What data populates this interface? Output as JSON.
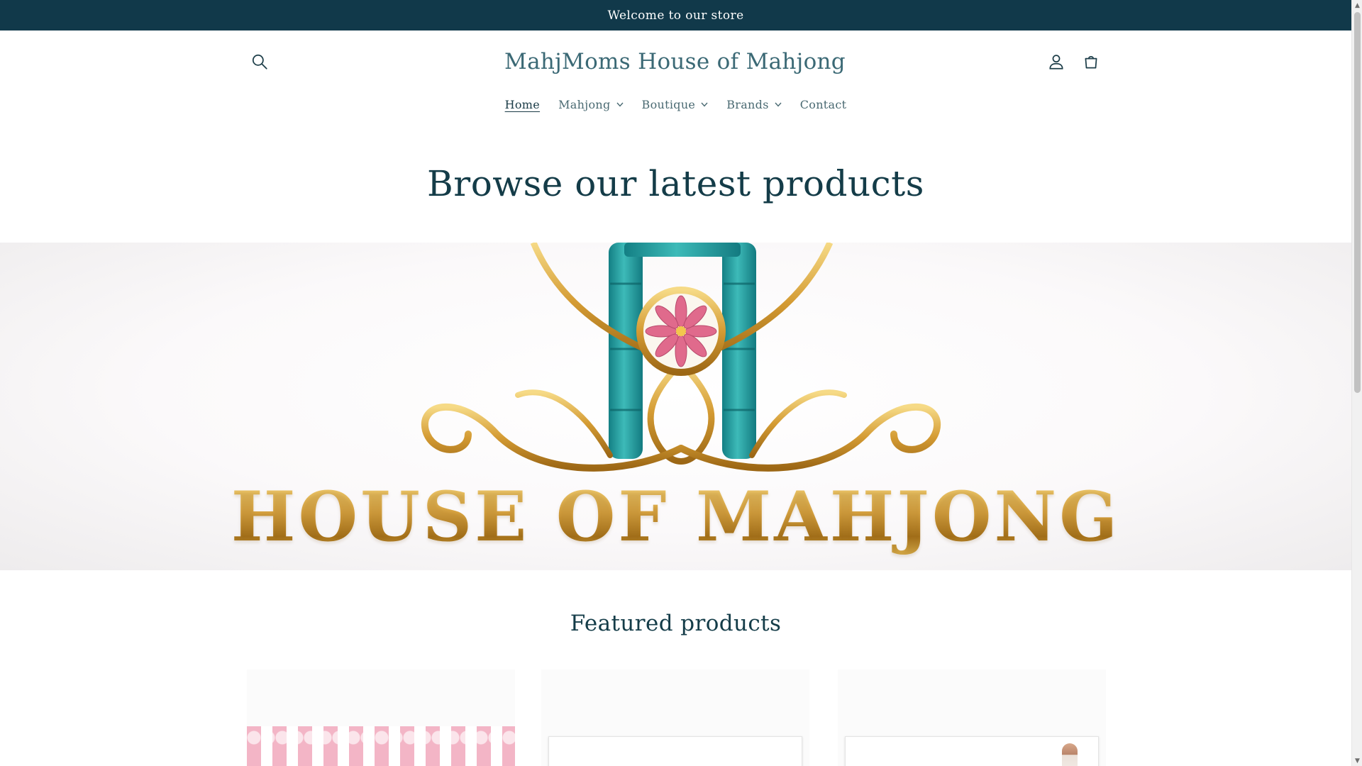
{
  "announcement": {
    "text": "Welcome to our store"
  },
  "header": {
    "store_name": "MahjMoms House of Mahjong",
    "icons": [
      "search-icon",
      "account-icon",
      "cart-icon"
    ]
  },
  "nav": {
    "items": [
      {
        "label": "Home",
        "active": true,
        "has_dropdown": false
      },
      {
        "label": "Mahjong",
        "active": false,
        "has_dropdown": true
      },
      {
        "label": "Boutique",
        "active": false,
        "has_dropdown": true
      },
      {
        "label": "Brands",
        "active": false,
        "has_dropdown": true
      },
      {
        "label": "Contact",
        "active": false,
        "has_dropdown": false
      }
    ]
  },
  "main": {
    "browse_heading": "Browse our latest products",
    "hero": {
      "logo_text": "HOUSE OF MAHJONG"
    },
    "featured_heading": "Featured products",
    "products": [
      {
        "kind": "pink striped product image"
      },
      {
        "kind": "boxed product image"
      },
      {
        "kind": "boxed product image with figure"
      }
    ]
  },
  "colors": {
    "announcement_bg": "#11394a",
    "heading_text": "#143c48",
    "gold": "#d9a441",
    "teal": "#1f9a9c",
    "pink": "#f3b5c6"
  }
}
